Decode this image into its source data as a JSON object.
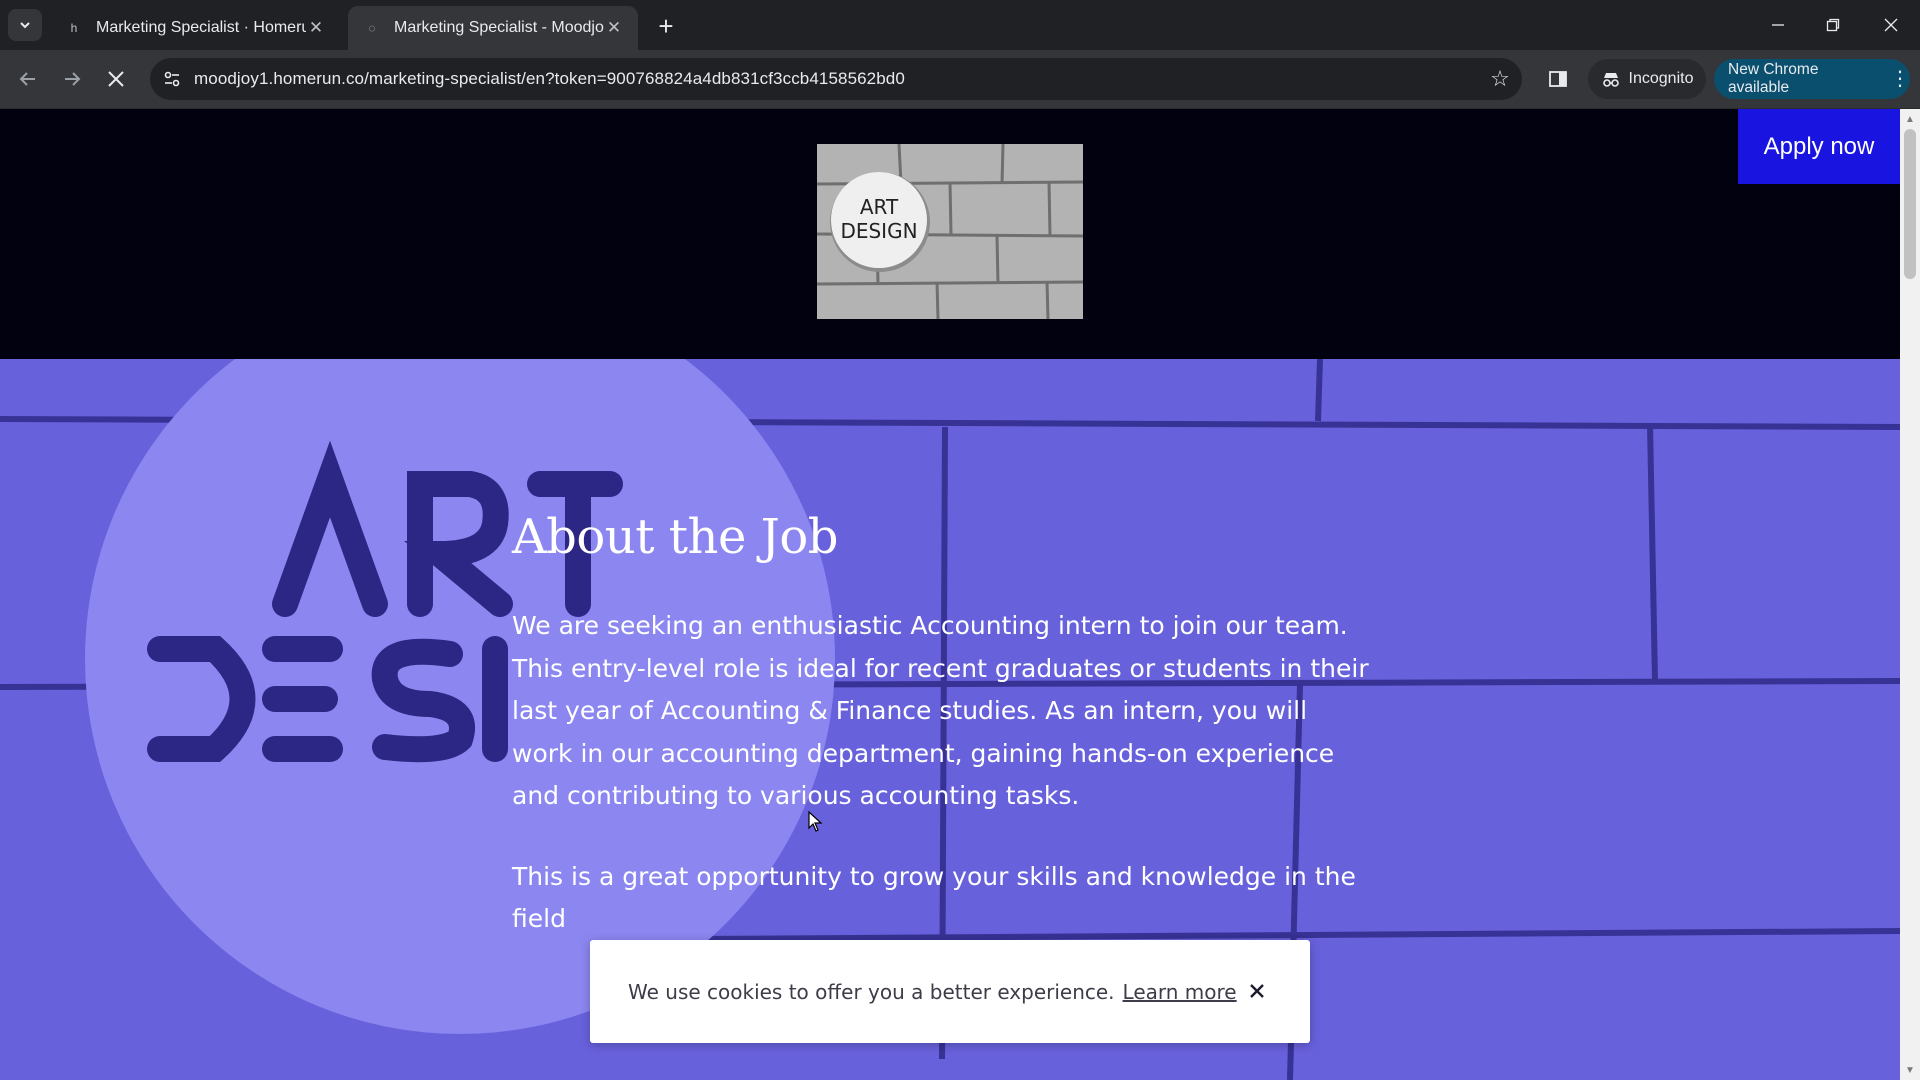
{
  "browser": {
    "tabs": [
      {
        "title": "Marketing Specialist · Homerun",
        "active": false
      },
      {
        "title": "Marketing Specialist - Moodjoy",
        "active": true
      }
    ],
    "url": "moodjoy1.homerun.co/marketing-specialist/en?token=900768824a4db831cf3ccb4158562bd0",
    "incognito_label": "Incognito",
    "update_label": "New Chrome available"
  },
  "page": {
    "apply_label": "Apply now",
    "logo_text": [
      "ART",
      "DESIGN"
    ],
    "section_title": "About the Job",
    "paragraphs": [
      "We are seeking an enthusiastic Accounting intern to join our team. This entry-level role is ideal for recent graduates or students in their last year of Accounting & Finance studies. As an intern, you will work in our accounting department, gaining hands-on experience and contributing to various accounting tasks.",
      "This is a great opportunity to grow your skills and knowledge in the field"
    ]
  },
  "cookie_banner": {
    "message": "We use cookies to offer you a better experience.",
    "link_label": "Learn more"
  },
  "colors": {
    "header_bg": "#02010f",
    "hero_bg": "#6a63dc",
    "apply_bg": "#1a14e0",
    "new_chrome_bg": "#0b4f6f"
  }
}
